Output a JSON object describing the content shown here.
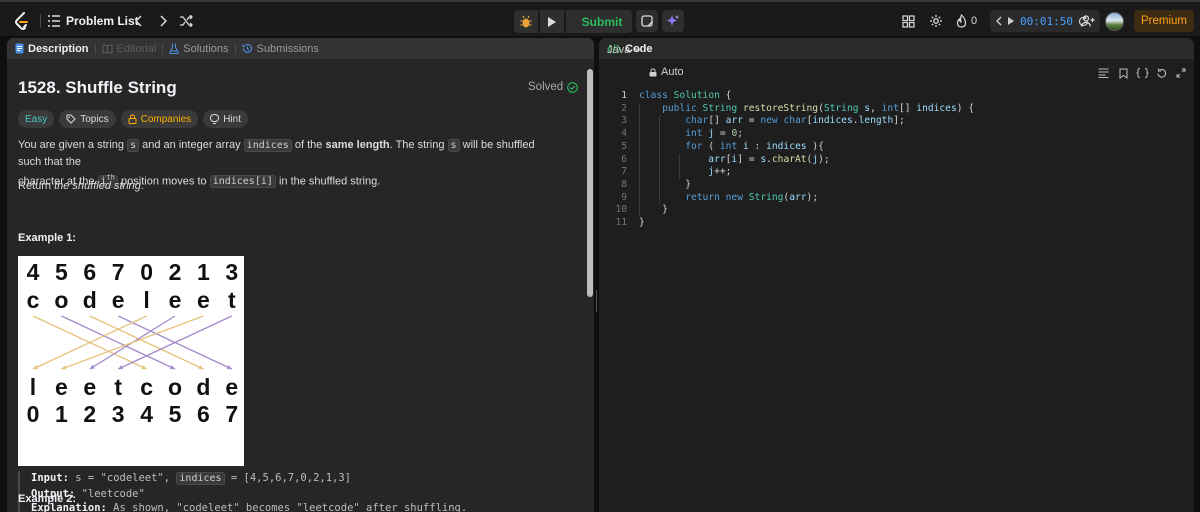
{
  "topbar": {
    "problem_list_label": "Problem List",
    "submit_label": "Submit",
    "streak_count": "0",
    "timer": "00:01:50",
    "premium_label": "Premium"
  },
  "left_tabs": [
    {
      "label": "Description",
      "active": true
    },
    {
      "label": "Editorial",
      "disabled": true
    },
    {
      "label": "Solutions"
    },
    {
      "label": "Submissions"
    }
  ],
  "problem": {
    "title": "1528. Shuffle String",
    "status": "Solved",
    "tags": [
      "Easy",
      "Topics",
      "Companies",
      "Hint"
    ],
    "para1": {
      "t1": "You are given a string ",
      "c1": "s",
      "t2": " and an integer array ",
      "c2": "indices",
      "t3": " of the ",
      "b1": "same length",
      "t4": ". The string ",
      "c3": "s",
      "t5": " will be shuffled such that the",
      "t6": "character at the ",
      "c4": "i",
      "sup": "th",
      "t7": " position moves to ",
      "c5": "indices[i]",
      "t8": " in the shuffled string."
    },
    "para2": {
      "t1": "Return ",
      "em": "the shuffled string",
      "t2": "."
    },
    "example1_heading": "Example 1:",
    "example2_heading": "Example 2:",
    "diagram": {
      "top_numbers": [
        "4",
        "5",
        "6",
        "7",
        "0",
        "2",
        "1",
        "3"
      ],
      "top_letters": [
        "c",
        "o",
        "d",
        "e",
        "l",
        "e",
        "e",
        "t"
      ],
      "bottom_letters": [
        "l",
        "e",
        "e",
        "t",
        "c",
        "o",
        "d",
        "e"
      ],
      "bottom_numbers": [
        "0",
        "1",
        "2",
        "3",
        "4",
        "5",
        "6",
        "7"
      ],
      "arrow_colors": [
        "#e6c27a",
        "#a48ac9"
      ]
    },
    "example1": {
      "input_label": "Input:",
      "input_s": " s = \"codeleet\", ",
      "input_code": "indices",
      "input_val": " = [4,5,6,7,0,2,1,3]",
      "output_label": "Output:",
      "output_val": " \"leetcode\"",
      "explanation_label": "Explanation:",
      "explanation_val": " As shown, \"codeleet\" becomes \"leetcode\" after shuffling."
    }
  },
  "code_panel": {
    "tab_label": "Code",
    "language": "Java",
    "mode": "Auto",
    "lines": [
      {
        "num": "1",
        "text": "class Solution {"
      },
      {
        "num": "2",
        "text": "    public String restoreString(String s, int[] indices) {"
      },
      {
        "num": "3",
        "text": "        char[] arr = new char[indices.length];"
      },
      {
        "num": "4",
        "text": "        int j = 0;"
      },
      {
        "num": "5",
        "text": "        for ( int i : indices ){"
      },
      {
        "num": "6",
        "text": "            arr[i] = s.charAt(j);"
      },
      {
        "num": "7",
        "text": "            j++;"
      },
      {
        "num": "8",
        "text": "        }"
      },
      {
        "num": "9",
        "text": "        return new String(arr);"
      },
      {
        "num": "10",
        "text": "    }"
      },
      {
        "num": "11",
        "text": "}"
      }
    ]
  }
}
